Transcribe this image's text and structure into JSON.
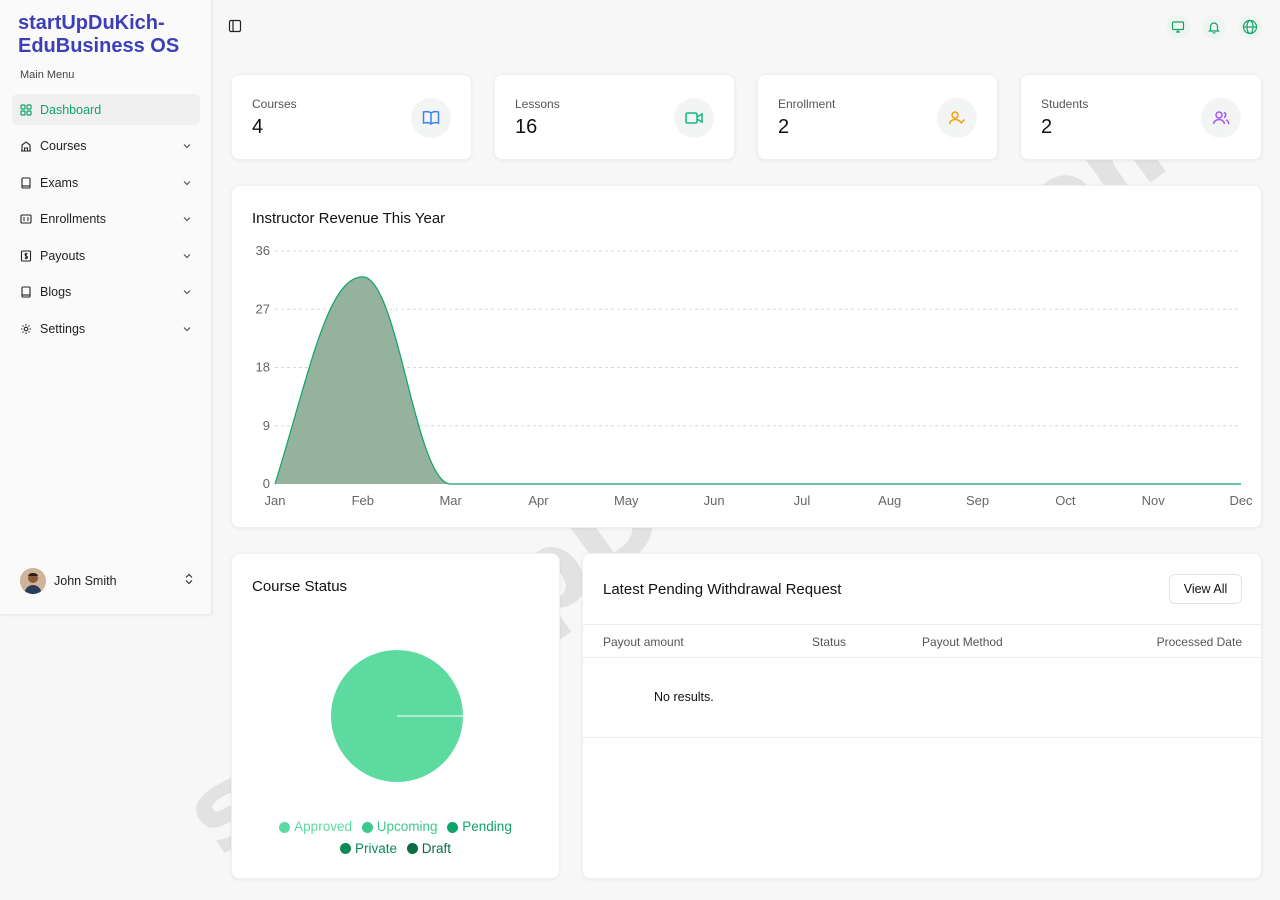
{
  "app": {
    "brand": "startUpDuKich-EduBusiness OS",
    "watermark": "startUpDuKich.Com"
  },
  "sidebar": {
    "section_label": "Main Menu",
    "items": [
      {
        "label": "Dashboard",
        "icon": "grid-icon",
        "active": true
      },
      {
        "label": "Courses",
        "icon": "building-icon"
      },
      {
        "label": "Exams",
        "icon": "book-icon"
      },
      {
        "label": "Enrollments",
        "icon": "id-card-icon"
      },
      {
        "label": "Payouts",
        "icon": "dollar-icon"
      },
      {
        "label": "Blogs",
        "icon": "notebook-icon"
      },
      {
        "label": "Settings",
        "icon": "gear-icon"
      }
    ],
    "user": {
      "name": "John Smith"
    }
  },
  "topbar": {
    "icons": [
      "monitor-icon",
      "bell-icon",
      "globe-icon"
    ]
  },
  "stats": [
    {
      "label": "Courses",
      "value": "4",
      "icon": "open-book-icon",
      "color": "#3b82f6"
    },
    {
      "label": "Lessons",
      "value": "16",
      "icon": "video-icon",
      "color": "#10b981"
    },
    {
      "label": "Enrollment",
      "value": "2",
      "icon": "user-check-icon",
      "color": "#f59e0b"
    },
    {
      "label": "Students",
      "value": "2",
      "icon": "users-icon",
      "color": "#a855f7"
    }
  ],
  "revenue_chart": {
    "title": "Instructor Revenue This Year"
  },
  "chart_data": [
    {
      "type": "area",
      "title": "Instructor Revenue This Year",
      "categories": [
        "Jan",
        "Feb",
        "Mar",
        "Apr",
        "May",
        "Jun",
        "Jul",
        "Aug",
        "Sep",
        "Oct",
        "Nov",
        "Dec"
      ],
      "values": [
        0,
        32,
        0,
        0,
        0,
        0,
        0,
        0,
        0,
        0,
        0,
        0
      ],
      "yticks": [
        0,
        9,
        18,
        27,
        36
      ],
      "ylim": [
        0,
        36
      ],
      "grid": true,
      "fill_color": "#8fae98",
      "line_color": "#10a36a"
    },
    {
      "type": "pie",
      "title": "Course Status",
      "labels": [
        "Approved",
        "Upcoming",
        "Pending",
        "Private",
        "Draft"
      ],
      "values": [
        4,
        0,
        0,
        0,
        0
      ],
      "colors": [
        "#5ddaa0",
        "#3cc98b",
        "#10a36a",
        "#0b8a58",
        "#0a6b45"
      ]
    }
  ],
  "course_status": {
    "title": "Course Status",
    "legend": [
      {
        "label": "Approved",
        "color": "#5ddaa0"
      },
      {
        "label": "Upcoming",
        "color": "#3cc98b"
      },
      {
        "label": "Pending",
        "color": "#10a36a"
      },
      {
        "label": "Private",
        "color": "#0b8a58"
      },
      {
        "label": "Draft",
        "color": "#0a6b45"
      }
    ]
  },
  "withdrawals": {
    "title": "Latest Pending Withdrawal Request",
    "view_all_label": "View All",
    "columns": [
      "Payout amount",
      "Status",
      "Payout Method",
      "Processed Date"
    ],
    "empty_text": "No results."
  }
}
